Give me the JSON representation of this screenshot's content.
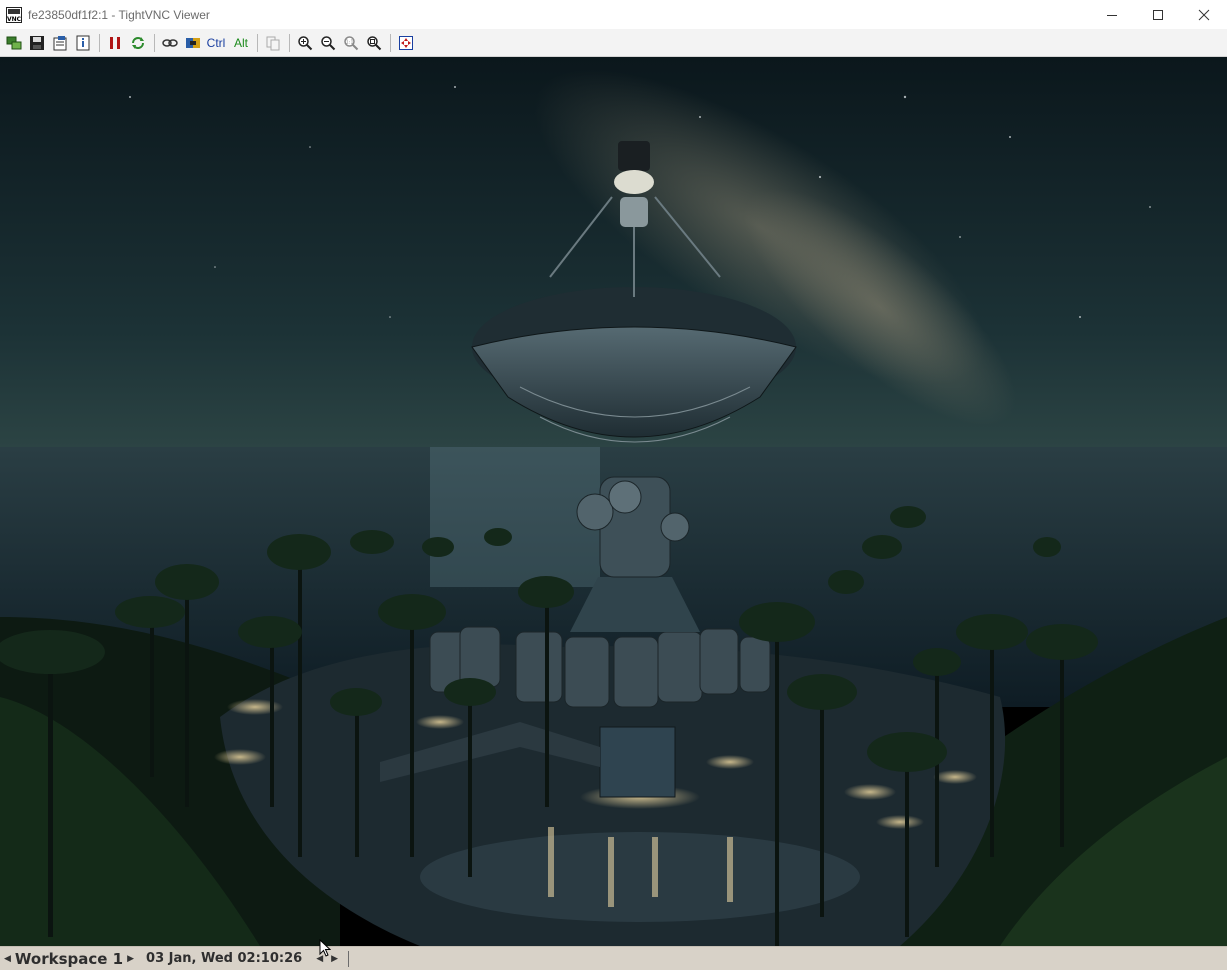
{
  "window": {
    "title": "fe23850df1f2:1 - TightVNC Viewer",
    "app_icon": "vnc-icon"
  },
  "window_controls": [
    "minimize-icon",
    "maximize-icon",
    "close-icon"
  ],
  "toolbar": {
    "ctrl_label": "Ctrl",
    "alt_label": "Alt",
    "buttons": [
      "new-connection-icon",
      "save-icon",
      "options-icon",
      "info-icon",
      "pause-icon",
      "refresh-icon",
      "transfer-icon",
      "file-transfer-icon",
      "ctrl-key",
      "alt-key",
      "copy-icon",
      "zoom-in-icon",
      "zoom-out-icon",
      "zoom-100-icon",
      "zoom-fit-icon",
      "fullscreen-icon"
    ]
  },
  "remote_desktop": {
    "wallpaper": "radio-telescope-night-island"
  },
  "taskbar": {
    "workspace_label": "Workspace 1",
    "clock": "03 Jan, Wed 02:10:26"
  },
  "colors": {
    "toolbar_bg": "#f3f3f3",
    "taskbar_bg": "#d8d2c8",
    "sky_top": "#0c1a20",
    "sea": "#12232c"
  }
}
